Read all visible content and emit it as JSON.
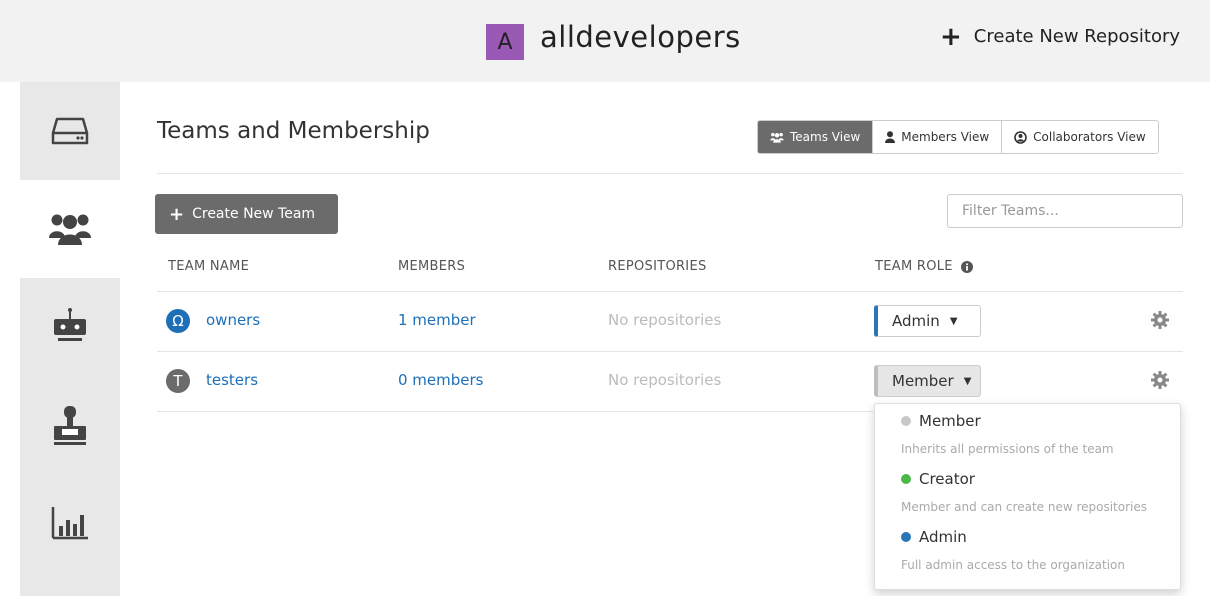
{
  "header": {
    "org_avatar_letter": "A",
    "org_avatar_color": "#9b59b6",
    "org_name": "alldevelopers",
    "create_repo_label": "Create New Repository"
  },
  "sidebar": {
    "items": [
      {
        "name": "repositories",
        "icon": "hard-drive-icon",
        "active": false
      },
      {
        "name": "teams",
        "icon": "users-icon",
        "active": true
      },
      {
        "name": "robot-accounts",
        "icon": "robot-icon",
        "active": false
      },
      {
        "name": "applications",
        "icon": "joystick-icon",
        "active": false
      },
      {
        "name": "usage-logs",
        "icon": "bar-chart-icon",
        "active": false
      }
    ]
  },
  "main": {
    "title": "Teams and Membership",
    "views": [
      {
        "label": "Teams View",
        "icon": "users-icon",
        "active": true
      },
      {
        "label": "Members View",
        "icon": "user-icon",
        "active": false
      },
      {
        "label": "Collaborators View",
        "icon": "user-circle-icon",
        "active": false
      }
    ],
    "create_team_label": "Create New Team",
    "filter_placeholder": "Filter Teams...",
    "columns": {
      "team_name": "TEAM NAME",
      "members": "MEMBERS",
      "repositories": "REPOSITORIES",
      "team_role": "TEAM ROLE"
    },
    "teams": [
      {
        "name": "owners",
        "avatar": "Ω",
        "avatar_color": "#1d6fb8",
        "members": "1 member",
        "repositories": "No repositories",
        "role": "Admin"
      },
      {
        "name": "testers",
        "avatar": "T",
        "avatar_color": "#6b6b6b",
        "members": "0 members",
        "repositories": "No repositories",
        "role": "Member"
      }
    ]
  },
  "role_dropdown": {
    "options": [
      {
        "label": "Member",
        "color": "#c8c8c8",
        "description": "Inherits all permissions of the team"
      },
      {
        "label": "Creator",
        "color": "#4cb848",
        "description": "Member and can create new repositories"
      },
      {
        "label": "Admin",
        "color": "#2a74b8",
        "description": "Full admin access to the organization"
      }
    ]
  },
  "colors": {
    "accent": "#1d6fb8",
    "button_dark": "#6b6b6b"
  }
}
